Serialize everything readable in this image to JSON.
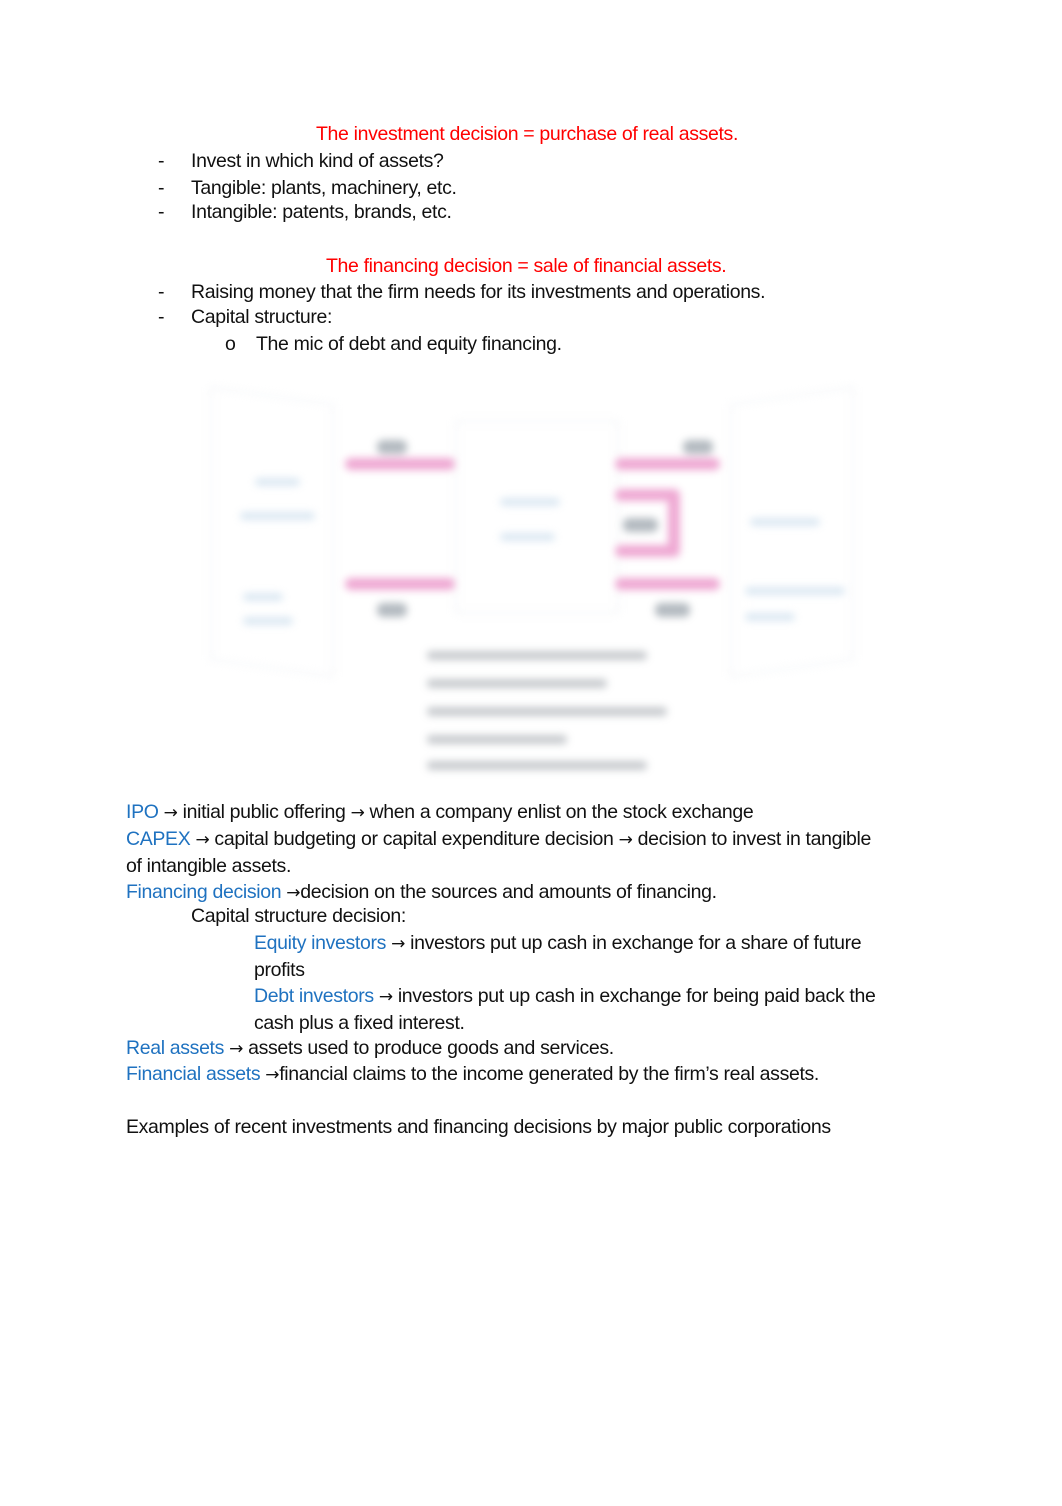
{
  "investment": {
    "heading": "The investment decision = purchase of real assets.",
    "bullets": [
      "Invest in which kind of assets?",
      "Tangible: plants, machinery, etc.",
      "Intangible: patents, brands, etc."
    ]
  },
  "financing": {
    "heading": "The financing decision = sale of financial assets.",
    "bullets": [
      "Raising money that the firm needs for its investments and operations.",
      "Capital structure:"
    ],
    "sub_bullet_marker": "o",
    "sub_bullets": [
      "The mic of debt and equity financing."
    ]
  },
  "bullet_marker": "-",
  "arrow": "→",
  "diagram": {
    "icon": "flow-of-cash-diagram (blurred, unreadable)",
    "colors": {
      "flow": "#e98bc4",
      "panel": "#eef1f4"
    }
  },
  "definitions": {
    "ipo": {
      "term": "IPO",
      "parts": [
        "initial public offering",
        "when a company enlist on the stock exchange"
      ]
    },
    "capex": {
      "term": "CAPEX",
      "parts": [
        "capital budgeting or capital expenditure decision",
        "decision to invest in tangible"
      ],
      "continuation": "of intangible assets."
    },
    "financing_decision": {
      "term": "Financing decision",
      "text": "decision on the sources and amounts of financing."
    },
    "capital_structure_label": "Capital structure decision:",
    "equity": {
      "term": "Equity investors",
      "text": "investors put up cash in exchange for a share of future",
      "continuation": "profits"
    },
    "debt": {
      "term": "Debt investors",
      "text": "investors put up cash in exchange for being paid back the",
      "continuation": "cash plus a fixed interest."
    },
    "real_assets": {
      "term": "Real assets",
      "text": "assets used to produce goods and services."
    },
    "financial_assets": {
      "term": "Financial assets",
      "text": "financial claims to the income generated by the firm’s real assets."
    }
  },
  "examples_line": "Examples of recent investments and financing decisions by major public corporations",
  "colors": {
    "heading": "#ff0000",
    "term": "#1f72c0",
    "body": "#111111"
  }
}
